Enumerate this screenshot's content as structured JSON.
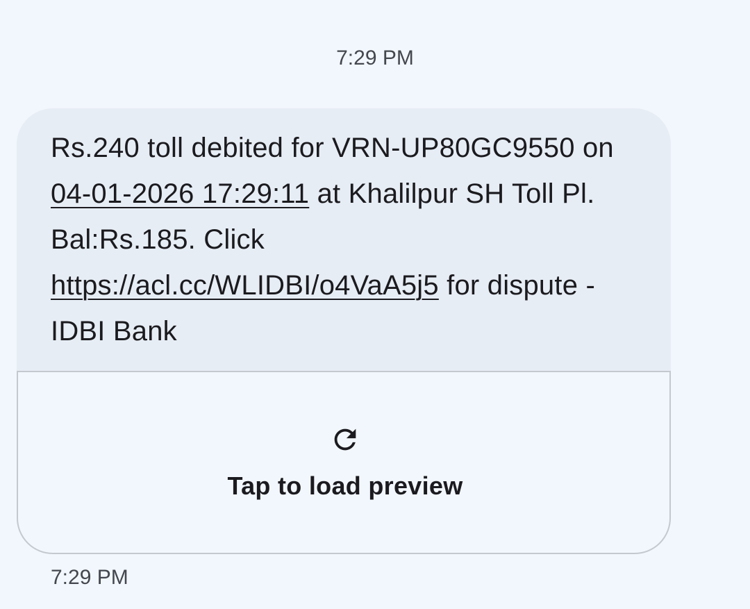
{
  "conversation": {
    "top_timestamp": "7:29 PM",
    "message": {
      "text_part1": "Rs.240 toll debited for VRN-UP80GC9550 on ",
      "datetime_link": "04-01-2026 17:29:11",
      "text_part2": " at Khalilpur SH Toll Pl. Bal:Rs.185. Click ",
      "url_link": "https://acl.cc/WLIDBI/o4VaA5j5",
      "text_part3": " for dispute - IDBI Bank",
      "preview_icon": "refresh-icon",
      "preview_label": "Tap to load preview",
      "timestamp": "7:29 PM"
    }
  },
  "colors": {
    "background": "#f2f7fd",
    "bubble": "#e7edf5",
    "text": "#1b1b1f",
    "secondary_text": "#44474e",
    "border": "#c4c8cf"
  }
}
